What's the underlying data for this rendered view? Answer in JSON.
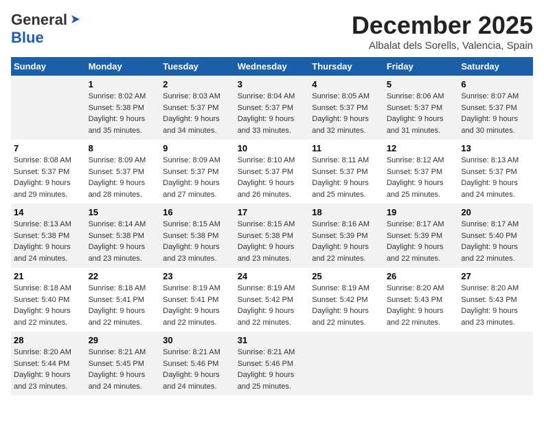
{
  "logo": {
    "line1_black": "General",
    "line2_blue": "Blue",
    "arrow_color": "#1a5fa8"
  },
  "header": {
    "month_year": "December 2025",
    "location": "Albalat dels Sorells, Valencia, Spain"
  },
  "weekdays": [
    "Sunday",
    "Monday",
    "Tuesday",
    "Wednesday",
    "Thursday",
    "Friday",
    "Saturday"
  ],
  "rows": [
    [
      {
        "day": "",
        "sunrise": "",
        "sunset": "",
        "daylight": ""
      },
      {
        "day": "1",
        "sunrise": "8:02 AM",
        "sunset": "5:38 PM",
        "daylight": "9 hours and 35 minutes."
      },
      {
        "day": "2",
        "sunrise": "8:03 AM",
        "sunset": "5:37 PM",
        "daylight": "9 hours and 34 minutes."
      },
      {
        "day": "3",
        "sunrise": "8:04 AM",
        "sunset": "5:37 PM",
        "daylight": "9 hours and 33 minutes."
      },
      {
        "day": "4",
        "sunrise": "8:05 AM",
        "sunset": "5:37 PM",
        "daylight": "9 hours and 32 minutes."
      },
      {
        "day": "5",
        "sunrise": "8:06 AM",
        "sunset": "5:37 PM",
        "daylight": "9 hours and 31 minutes."
      },
      {
        "day": "6",
        "sunrise": "8:07 AM",
        "sunset": "5:37 PM",
        "daylight": "9 hours and 30 minutes."
      }
    ],
    [
      {
        "day": "7",
        "sunrise": "8:08 AM",
        "sunset": "5:37 PM",
        "daylight": "9 hours and 29 minutes."
      },
      {
        "day": "8",
        "sunrise": "8:09 AM",
        "sunset": "5:37 PM",
        "daylight": "9 hours and 28 minutes."
      },
      {
        "day": "9",
        "sunrise": "8:09 AM",
        "sunset": "5:37 PM",
        "daylight": "9 hours and 27 minutes."
      },
      {
        "day": "10",
        "sunrise": "8:10 AM",
        "sunset": "5:37 PM",
        "daylight": "9 hours and 26 minutes."
      },
      {
        "day": "11",
        "sunrise": "8:11 AM",
        "sunset": "5:37 PM",
        "daylight": "9 hours and 25 minutes."
      },
      {
        "day": "12",
        "sunrise": "8:12 AM",
        "sunset": "5:37 PM",
        "daylight": "9 hours and 25 minutes."
      },
      {
        "day": "13",
        "sunrise": "8:13 AM",
        "sunset": "5:37 PM",
        "daylight": "9 hours and 24 minutes."
      }
    ],
    [
      {
        "day": "14",
        "sunrise": "8:13 AM",
        "sunset": "5:38 PM",
        "daylight": "9 hours and 24 minutes."
      },
      {
        "day": "15",
        "sunrise": "8:14 AM",
        "sunset": "5:38 PM",
        "daylight": "9 hours and 23 minutes."
      },
      {
        "day": "16",
        "sunrise": "8:15 AM",
        "sunset": "5:38 PM",
        "daylight": "9 hours and 23 minutes."
      },
      {
        "day": "17",
        "sunrise": "8:15 AM",
        "sunset": "5:38 PM",
        "daylight": "9 hours and 23 minutes."
      },
      {
        "day": "18",
        "sunrise": "8:16 AM",
        "sunset": "5:39 PM",
        "daylight": "9 hours and 22 minutes."
      },
      {
        "day": "19",
        "sunrise": "8:17 AM",
        "sunset": "5:39 PM",
        "daylight": "9 hours and 22 minutes."
      },
      {
        "day": "20",
        "sunrise": "8:17 AM",
        "sunset": "5:40 PM",
        "daylight": "9 hours and 22 minutes."
      }
    ],
    [
      {
        "day": "21",
        "sunrise": "8:18 AM",
        "sunset": "5:40 PM",
        "daylight": "9 hours and 22 minutes."
      },
      {
        "day": "22",
        "sunrise": "8:18 AM",
        "sunset": "5:41 PM",
        "daylight": "9 hours and 22 minutes."
      },
      {
        "day": "23",
        "sunrise": "8:19 AM",
        "sunset": "5:41 PM",
        "daylight": "9 hours and 22 minutes."
      },
      {
        "day": "24",
        "sunrise": "8:19 AM",
        "sunset": "5:42 PM",
        "daylight": "9 hours and 22 minutes."
      },
      {
        "day": "25",
        "sunrise": "8:19 AM",
        "sunset": "5:42 PM",
        "daylight": "9 hours and 22 minutes."
      },
      {
        "day": "26",
        "sunrise": "8:20 AM",
        "sunset": "5:43 PM",
        "daylight": "9 hours and 22 minutes."
      },
      {
        "day": "27",
        "sunrise": "8:20 AM",
        "sunset": "5:43 PM",
        "daylight": "9 hours and 23 minutes."
      }
    ],
    [
      {
        "day": "28",
        "sunrise": "8:20 AM",
        "sunset": "5:44 PM",
        "daylight": "9 hours and 23 minutes."
      },
      {
        "day": "29",
        "sunrise": "8:21 AM",
        "sunset": "5:45 PM",
        "daylight": "9 hours and 24 minutes."
      },
      {
        "day": "30",
        "sunrise": "8:21 AM",
        "sunset": "5:46 PM",
        "daylight": "9 hours and 24 minutes."
      },
      {
        "day": "31",
        "sunrise": "8:21 AM",
        "sunset": "5:46 PM",
        "daylight": "9 hours and 25 minutes."
      },
      {
        "day": "",
        "sunrise": "",
        "sunset": "",
        "daylight": ""
      },
      {
        "day": "",
        "sunrise": "",
        "sunset": "",
        "daylight": ""
      },
      {
        "day": "",
        "sunrise": "",
        "sunset": "",
        "daylight": ""
      }
    ]
  ]
}
